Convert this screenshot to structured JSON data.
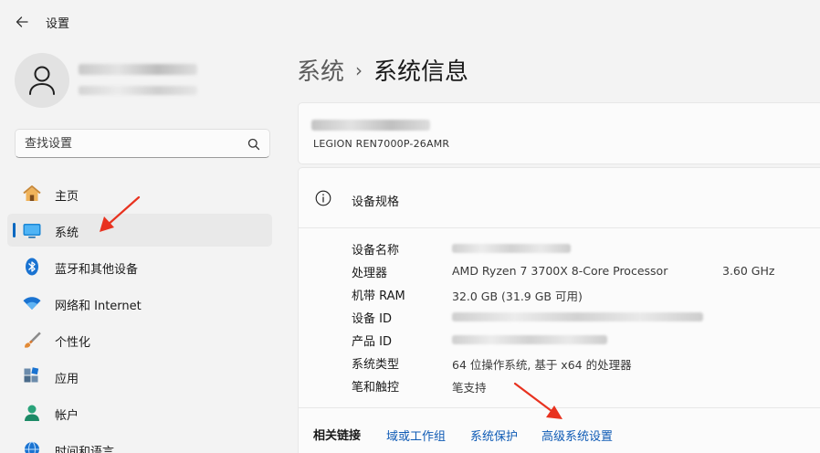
{
  "window": {
    "title": "设置"
  },
  "search": {
    "placeholder": "查找设置"
  },
  "sidebar": {
    "items": [
      {
        "label": "主页",
        "icon": "home-icon"
      },
      {
        "label": "系统",
        "icon": "system-icon"
      },
      {
        "label": "蓝牙和其他设备",
        "icon": "bluetooth-icon"
      },
      {
        "label": "网络和 Internet",
        "icon": "wifi-icon"
      },
      {
        "label": "个性化",
        "icon": "brush-icon"
      },
      {
        "label": "应用",
        "icon": "apps-icon"
      },
      {
        "label": "帐户",
        "icon": "account-icon"
      },
      {
        "label": "时间和语言",
        "icon": "globe-icon"
      }
    ],
    "active_index": 1
  },
  "breadcrumb": {
    "parent": "系统",
    "separator": "›",
    "current": "系统信息"
  },
  "device": {
    "model": "LEGION REN7000P-26AMR"
  },
  "specs": {
    "title": "设备规格",
    "rows": [
      {
        "label": "设备名称",
        "value": ""
      },
      {
        "label": "处理器",
        "value": "AMD Ryzen 7 3700X 8-Core Processor",
        "extra": "3.60 GHz"
      },
      {
        "label": "机带 RAM",
        "value": "32.0 GB (31.9 GB 可用)"
      },
      {
        "label": "设备 ID",
        "value": ""
      },
      {
        "label": "产品 ID",
        "value": ""
      },
      {
        "label": "系统类型",
        "value": "64 位操作系统, 基于 x64 的处理器"
      },
      {
        "label": "笔和触控",
        "value": "笔支持"
      }
    ]
  },
  "related": {
    "title": "相关链接",
    "links": [
      "域或工作组",
      "系统保护",
      "高级系统设置"
    ]
  },
  "colors": {
    "accent": "#0067c0",
    "link": "#0f5bb5",
    "annotation_arrow": "#e8321f"
  }
}
